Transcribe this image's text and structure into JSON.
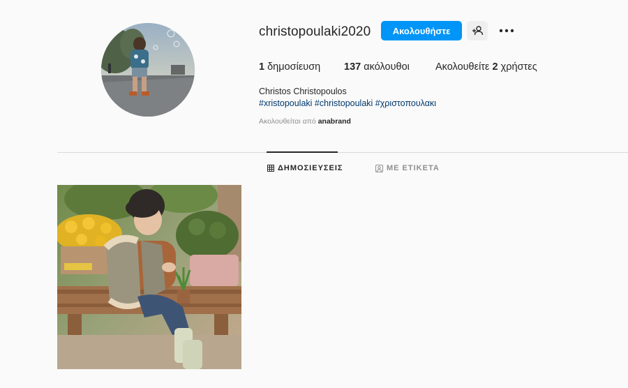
{
  "profile": {
    "username": "christopoulaki2020",
    "follow_label": "Ακολουθήστε",
    "suggest_icon": "person-add-icon",
    "more_icon": "more-options-icon",
    "stats": {
      "posts_count": "1",
      "posts_label": " δημοσίευση",
      "followers_count": "137",
      "followers_label": " ακόλουθοι",
      "following_prefix": "Ακολουθείτε ",
      "following_count": "2",
      "following_label": " χρήστες"
    },
    "full_name": "Christos Christopoulos",
    "hashtags": [
      "#xristopoulaki",
      "#christopoulaki",
      "#χριστοπουλακι"
    ],
    "followed_by_prefix": "Ακολουθείται από ",
    "followed_by_user": "anabrand"
  },
  "tabs": [
    {
      "label": "ΔΗΜΟΣΙΕΥΣΕΙΣ",
      "icon": "grid-icon",
      "active": true
    },
    {
      "label": "ΜΕ ΕΤΙΚΕΤΑ",
      "icon": "tagged-icon",
      "active": false
    }
  ],
  "colors": {
    "accent": "#0095f6",
    "background": "#fafafa",
    "text": "#262626",
    "secondary_text": "#8e8e8e",
    "hashtag": "#00376b",
    "divider": "#dbdbdb"
  }
}
